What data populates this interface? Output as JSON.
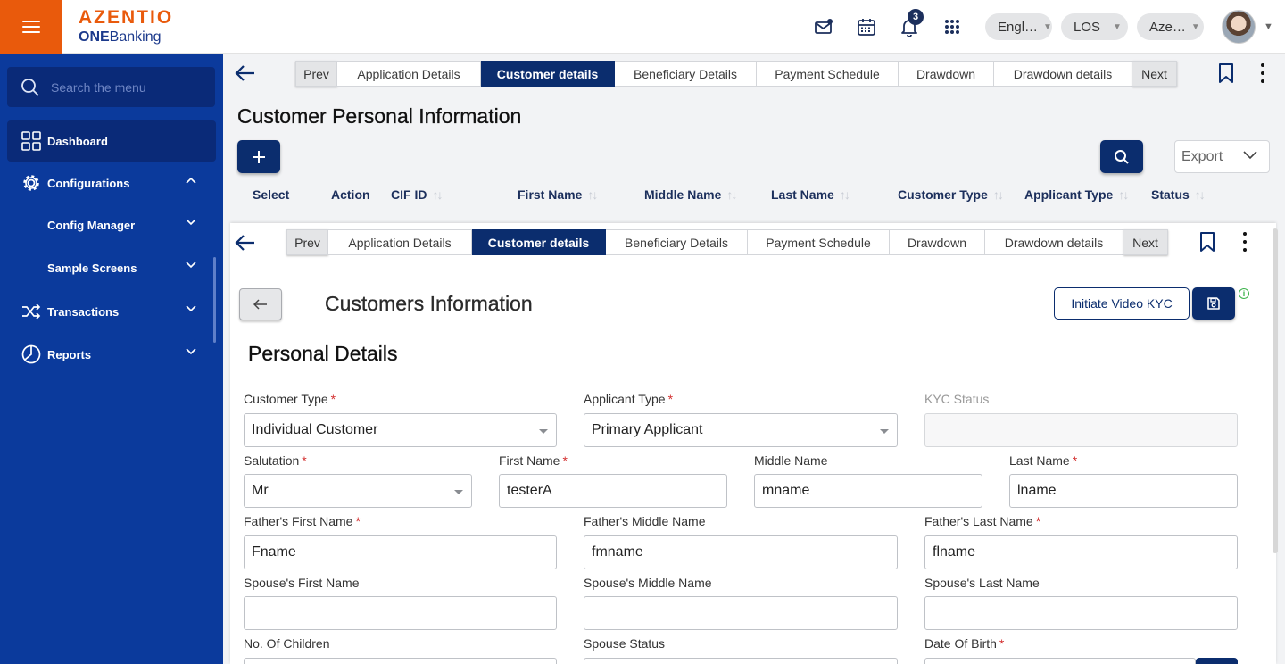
{
  "header": {
    "brand": "AZENTIO",
    "product_prefix": "ONE",
    "product_suffix": "Banking",
    "notification_count": "3",
    "language": "Engl…",
    "module": "LOS",
    "entity": "Aze…"
  },
  "sidebar": {
    "search_placeholder": "Search the menu",
    "items": [
      {
        "label": "Dashboard",
        "icon": "grid-icon"
      },
      {
        "label": "Configurations",
        "icon": "gear-icon"
      },
      {
        "label": "Config Manager"
      },
      {
        "label": "Sample Screens"
      },
      {
        "label": "Transactions",
        "icon": "shuffle-icon"
      },
      {
        "label": "Reports",
        "icon": "pie-chart-icon"
      }
    ]
  },
  "tabs": [
    "Prev",
    "Application Details",
    "Customer details",
    "Beneficiary Details",
    "Payment Schedule",
    "Drawdown",
    "Drawdown details",
    "Next"
  ],
  "active_tab": "Customer details",
  "background_page": {
    "title": "Customer Personal Information",
    "export_label": "Export",
    "columns": [
      "Select",
      "Action",
      "CIF ID",
      "First Name",
      "Middle Name",
      "Last Name",
      "Customer Type",
      "Applicant Type",
      "Status"
    ]
  },
  "form": {
    "title": "Customers Information",
    "kyc_button": "Initiate Video KYC",
    "section": "Personal Details",
    "fields": {
      "customer_type": {
        "label": "Customer Type",
        "value": "Individual Customer"
      },
      "applicant_type": {
        "label": "Applicant Type",
        "value": "Primary Applicant"
      },
      "kyc_status": {
        "label": "KYC Status",
        "value": ""
      },
      "salutation": {
        "label": "Salutation",
        "value": "Mr"
      },
      "first_name": {
        "label": "First Name",
        "value": "testerA"
      },
      "middle_name": {
        "label": "Middle Name",
        "value": "mname"
      },
      "last_name": {
        "label": "Last Name",
        "value": "lname"
      },
      "father_first": {
        "label": "Father's First Name",
        "value": "Fname"
      },
      "father_middle": {
        "label": "Father's Middle Name",
        "value": "fmname"
      },
      "father_last": {
        "label": "Father's Last Name",
        "value": "flname"
      },
      "spouse_first": {
        "label": "Spouse's First Name",
        "value": ""
      },
      "spouse_middle": {
        "label": "Spouse's Middle Name",
        "value": ""
      },
      "spouse_last": {
        "label": "Spouse's Last Name",
        "value": ""
      },
      "children": {
        "label": "No. Of Children"
      },
      "spouse_status": {
        "label": "Spouse Status"
      },
      "dob": {
        "label": "Date Of Birth"
      }
    },
    "required_mark": "*"
  },
  "colors": {
    "brand_orange": "#e95a0c",
    "sidebar_blue": "#0b3a9c",
    "primary_navy": "#0b2d6e"
  }
}
